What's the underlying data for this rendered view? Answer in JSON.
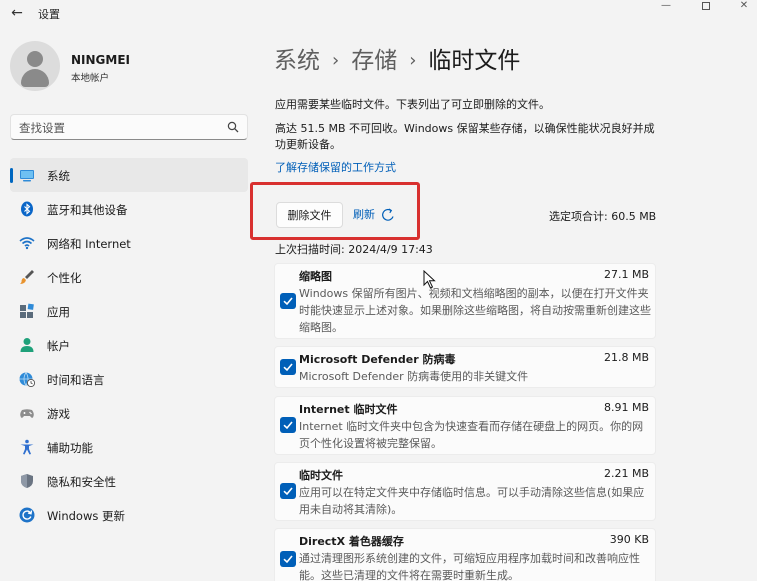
{
  "window": {
    "back": "←",
    "title": "设置",
    "minimize": "—",
    "close": "✕"
  },
  "user": {
    "name": "NINGMEI",
    "account_type": "本地帐户"
  },
  "search": {
    "placeholder": "查找设置"
  },
  "sidebar": {
    "items": [
      {
        "label": "系统",
        "icon": "system-icon",
        "active": true
      },
      {
        "label": "蓝牙和其他设备",
        "icon": "bluetooth-icon"
      },
      {
        "label": "网络和 Internet",
        "icon": "wifi-icon"
      },
      {
        "label": "个性化",
        "icon": "brush-icon"
      },
      {
        "label": "应用",
        "icon": "apps-icon"
      },
      {
        "label": "帐户",
        "icon": "account-icon"
      },
      {
        "label": "时间和语言",
        "icon": "globe-clock-icon"
      },
      {
        "label": "游戏",
        "icon": "gamepad-icon"
      },
      {
        "label": "辅助功能",
        "icon": "accessibility-icon"
      },
      {
        "label": "隐私和安全性",
        "icon": "shield-icon"
      },
      {
        "label": "Windows 更新",
        "icon": "update-icon"
      }
    ]
  },
  "breadcrumb": {
    "part1": "系统",
    "sep": "›",
    "part2": "存储",
    "current": "临时文件"
  },
  "main": {
    "desc1": "应用需要某些临时文件。下表列出了可立即删除的文件。",
    "desc2": "高达 51.5 MB 不可回收。Windows 保留某些存储，以确保性能状况良好并成功更新设备。",
    "learn_link": "了解存储保留的工作方式",
    "delete_button": "删除文件",
    "refresh_button": "刷新",
    "total_selected": "选定项合计: 60.5 MB",
    "last_scan": "上次扫描时间: 2024/4/9 17:43"
  },
  "files": [
    {
      "title": "缩略图",
      "size": "27.1 MB",
      "desc": "Windows 保留所有图片、视频和文档缩略图的副本，以便在打开文件夹时能快速显示上述对象。如果删除这些缩略图，将自动按需重新创建这些缩略图。",
      "checked": true
    },
    {
      "title": "Microsoft Defender 防病毒",
      "size": "21.8 MB",
      "desc": "Microsoft Defender 防病毒使用的非关键文件",
      "checked": true
    },
    {
      "title": "Internet 临时文件",
      "size": "8.91 MB",
      "desc": "Internet 临时文件夹中包含为快速查看而存储在硬盘上的网页。你的网页个性化设置将被完整保留。",
      "checked": true
    },
    {
      "title": "临时文件",
      "size": "2.21 MB",
      "desc": "应用可以在特定文件夹中存储临时信息。可以手动清除这些信息(如果应用未自动将其清除)。",
      "checked": true
    },
    {
      "title": "DirectX 着色器缓存",
      "size": "390 KB",
      "desc": "通过清理图形系统创建的文件，可缩短应用程序加载时间和改善响应性能。这些已清理的文件将在需要时重新生成。",
      "checked": true
    }
  ],
  "colors": {
    "accent": "#005fb8",
    "highlight": "#d8302f"
  }
}
